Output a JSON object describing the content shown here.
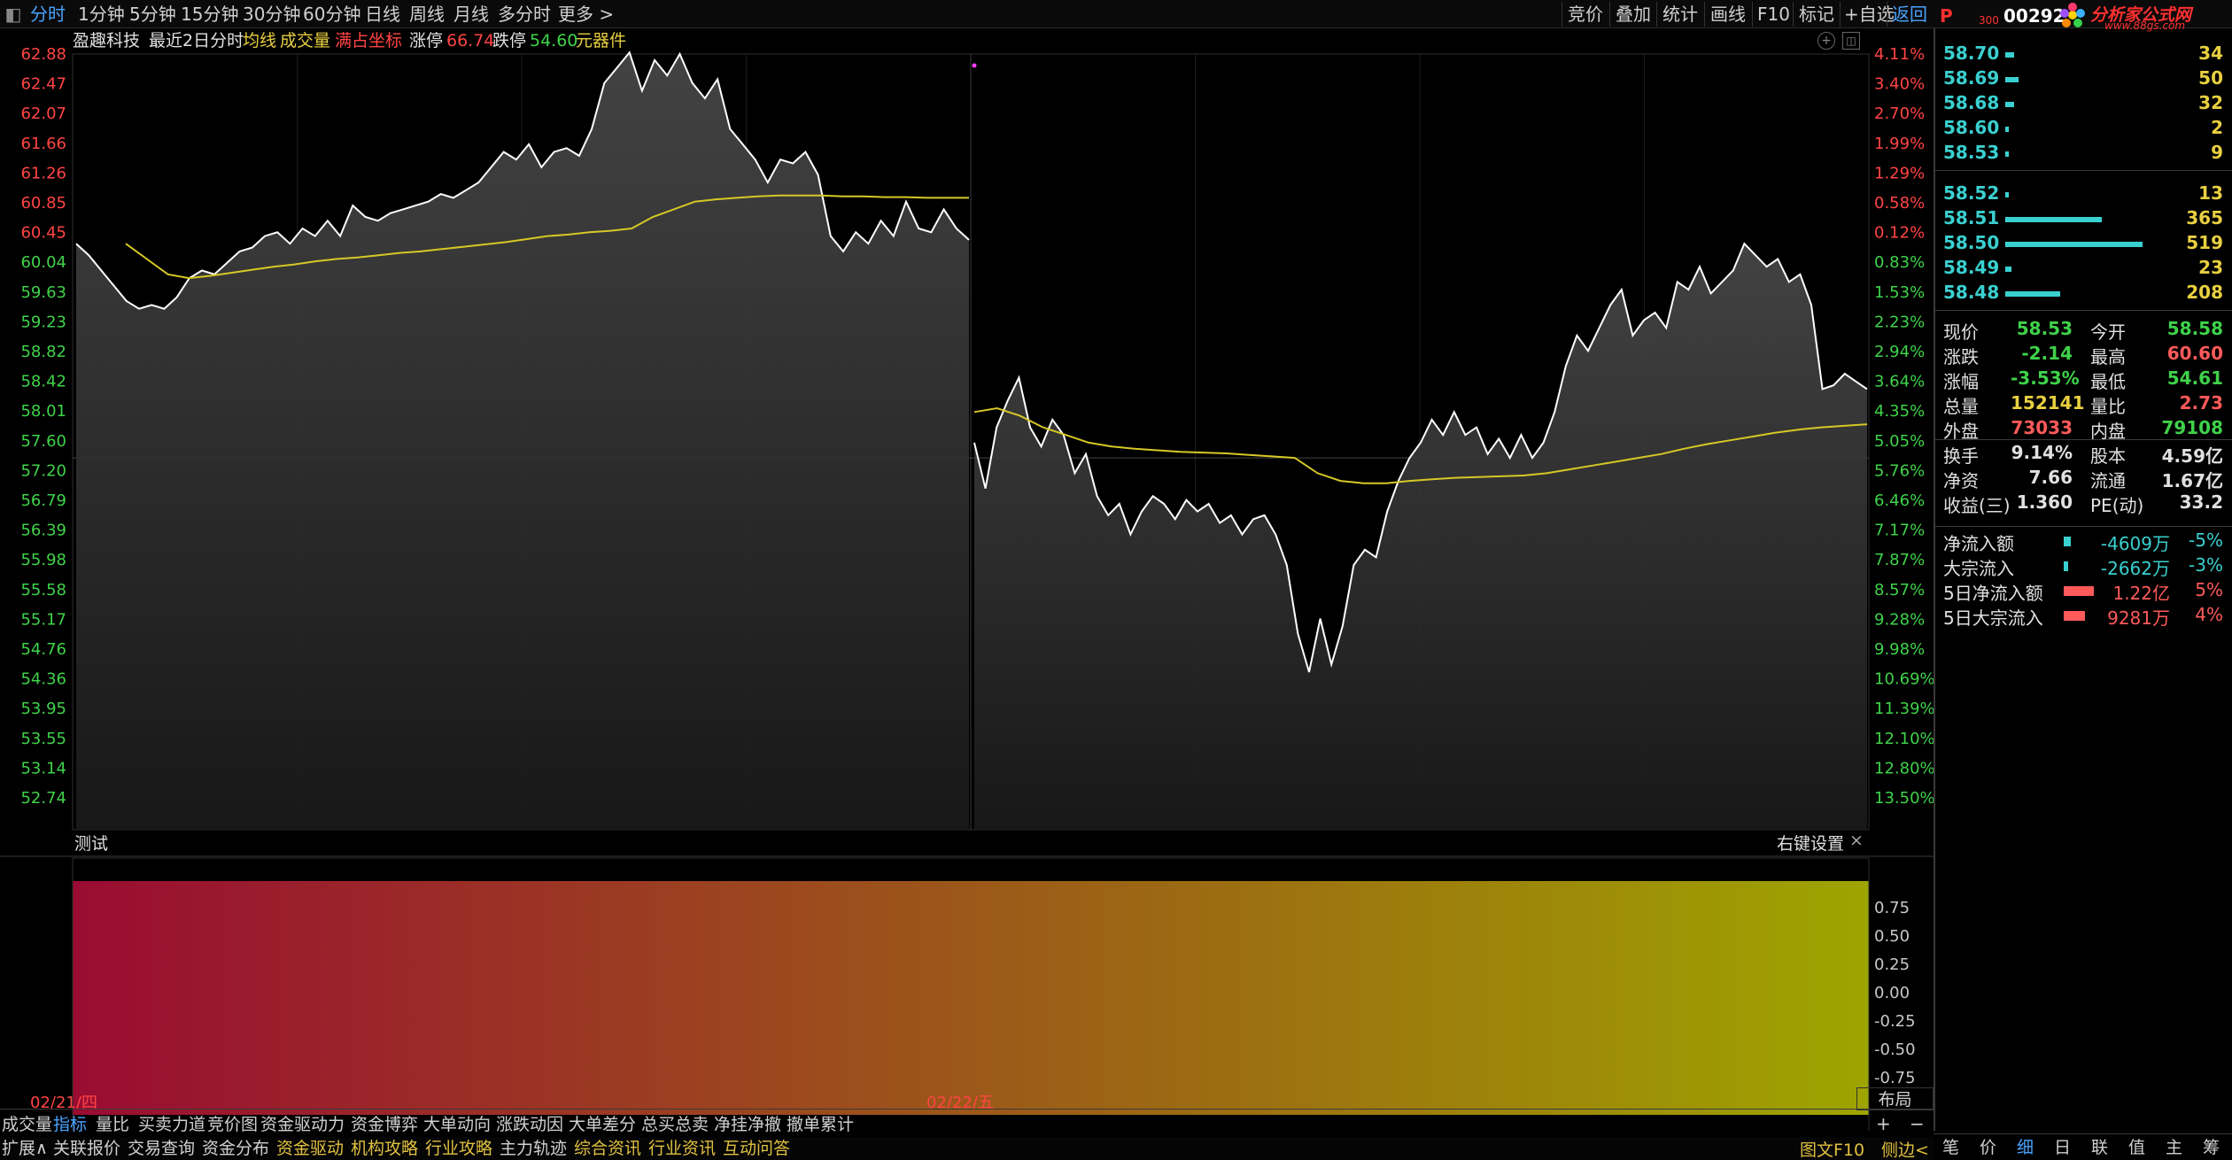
{
  "top_toolbar": {
    "period_tabs": [
      "分时",
      "1分钟",
      "5分钟",
      "15分钟",
      "30分钟",
      "60分钟",
      "日线",
      "周线",
      "月线",
      "多分时",
      "更多 >"
    ],
    "active_tab": "分时",
    "right_tools": [
      "竞价",
      "叠加",
      "统计",
      "画线",
      "F10",
      "标记",
      "+自选",
      "返回"
    ],
    "back_label": "返回"
  },
  "stock": {
    "name": "盈趣科技",
    "mode": "最近2日分时",
    "avg_label": "均线",
    "volume_label": "成交量",
    "fullcoord_label": "满占坐标",
    "limit_up_label": "涨停",
    "limit_up_value": "66.74",
    "limit_down_label": "跌停",
    "limit_down_value": "54.60",
    "sector": "元器件",
    "code": "00292",
    "code_prefix": "P",
    "code_sub": "300"
  },
  "brand": {
    "title": "分析家公式网",
    "url": "www.88gs.com"
  },
  "price_axis": [
    "62.88",
    "62.47",
    "62.07",
    "61.66",
    "61.26",
    "60.85",
    "60.45",
    "60.04",
    "59.63",
    "59.23",
    "58.82",
    "58.42",
    "58.01",
    "57.60",
    "57.20",
    "56.79",
    "56.39",
    "55.98",
    "55.58",
    "55.17",
    "54.76",
    "54.36",
    "53.95",
    "53.55",
    "53.14",
    "52.74"
  ],
  "pct_axis": [
    "4.11%",
    "3.40%",
    "2.70%",
    "1.99%",
    "1.29%",
    "0.58%",
    "0.12%",
    "0.83%",
    "1.53%",
    "2.23%",
    "2.94%",
    "3.64%",
    "4.35%",
    "5.05%",
    "5.76%",
    "6.46%",
    "7.17%",
    "7.87%",
    "8.57%",
    "9.28%",
    "9.98%",
    "10.69%",
    "11.39%",
    "12.10%",
    "12.80%",
    "13.50%"
  ],
  "indicator": {
    "title": "测试",
    "settings_label": "右键设置",
    "close_label": "×",
    "axis": [
      "0.75",
      "0.50",
      "0.25",
      "0.00",
      "-0.25",
      "-0.50",
      "-0.75"
    ]
  },
  "dates": [
    "02/21/四",
    "02/22/五"
  ],
  "colors": {
    "price_line": "#ffffff",
    "avg_line": "#d6c826",
    "axis_up": "#ff4444",
    "axis_down": "#3fd24a",
    "accent": "#4aa3ff",
    "bar_cyan": "#3ad0d0",
    "gradient_start": "#9a0c32",
    "gradient_end": "#9ea400"
  },
  "chart_data": {
    "type": "line",
    "x_sessions": [
      "02/21/四",
      "02/22/五"
    ],
    "ylim": [
      52.74,
      62.88
    ],
    "reference_price": 60.45,
    "series": [
      {
        "name": "价格",
        "session1": [
          60.4,
          60.25,
          60.05,
          59.85,
          59.65,
          59.55,
          59.6,
          59.55,
          59.7,
          59.95,
          60.05,
          60.0,
          60.15,
          60.3,
          60.35,
          60.5,
          60.55,
          60.4,
          60.6,
          60.5,
          60.7,
          60.5,
          60.9,
          60.75,
          60.7,
          60.8,
          60.85,
          60.9,
          60.95,
          61.05,
          61.0,
          61.1,
          61.2,
          61.4,
          61.6,
          61.5,
          61.7,
          61.4,
          61.6,
          61.65,
          61.55,
          61.9,
          62.5,
          62.7,
          62.9,
          62.4,
          62.8,
          62.6,
          62.88,
          62.5,
          62.3,
          62.55,
          61.9,
          61.7,
          61.5,
          61.2,
          61.5,
          61.45,
          61.6,
          61.3,
          60.5,
          60.3,
          60.55,
          60.4,
          60.7,
          60.5,
          60.95,
          60.6,
          60.55,
          60.85,
          60.6,
          60.45
        ],
        "session2": [
          57.8,
          57.2,
          58.0,
          58.35,
          58.65,
          58.0,
          57.75,
          58.1,
          57.9,
          57.4,
          57.65,
          57.1,
          56.85,
          57.0,
          56.6,
          56.9,
          57.1,
          57.0,
          56.8,
          57.05,
          56.9,
          57.0,
          56.75,
          56.85,
          56.6,
          56.8,
          56.85,
          56.6,
          56.2,
          55.3,
          54.8,
          55.5,
          54.9,
          55.4,
          56.2,
          56.4,
          56.3,
          56.9,
          57.3,
          57.6,
          57.8,
          58.1,
          57.9,
          58.2,
          57.9,
          58.0,
          57.65,
          57.85,
          57.6,
          57.9,
          57.6,
          57.8,
          58.2,
          58.8,
          59.2,
          59.0,
          59.3,
          59.6,
          59.8,
          59.2,
          59.4,
          59.5,
          59.3,
          59.9,
          59.8,
          60.1,
          59.75,
          59.9,
          60.05,
          60.4,
          60.25,
          60.1,
          60.2,
          59.9,
          60.0,
          59.6,
          58.5,
          58.55,
          58.7,
          58.6,
          58.5
        ]
      },
      {
        "name": "均价",
        "session1": [
          60.4,
          60.2,
          60.0,
          59.95,
          59.98,
          60.02,
          60.06,
          60.1,
          60.13,
          60.17,
          60.2,
          60.22,
          60.25,
          60.28,
          60.3,
          60.33,
          60.36,
          60.39,
          60.42,
          60.46,
          60.5,
          60.52,
          60.55,
          60.57,
          60.6,
          60.75,
          60.85,
          60.95,
          60.98,
          61.0,
          61.02,
          61.03,
          61.03,
          61.03,
          61.02,
          61.02,
          61.01,
          61.01,
          61.0,
          61.0,
          61.0
        ],
        "session2": [
          58.2,
          58.25,
          58.15,
          58.0,
          57.9,
          57.8,
          57.75,
          57.72,
          57.7,
          57.68,
          57.67,
          57.66,
          57.64,
          57.62,
          57.6,
          57.4,
          57.3,
          57.27,
          57.27,
          57.3,
          57.32,
          57.34,
          57.35,
          57.36,
          57.37,
          57.4,
          57.45,
          57.5,
          57.55,
          57.6,
          57.65,
          57.72,
          57.78,
          57.83,
          57.88,
          57.93,
          57.97,
          58.0,
          58.02,
          58.04
        ]
      }
    ],
    "indicator_series": {
      "name": "测试",
      "ylim": [
        -0.75,
        0.75
      ],
      "gradient": [
        "#9a0c32",
        "#9ea400"
      ]
    },
    "grid": true
  },
  "order_book": {
    "asks": [
      {
        "price": "58.70",
        "vol": "34",
        "bar": 34
      },
      {
        "price": "58.69",
        "vol": "50",
        "bar": 50
      },
      {
        "price": "58.68",
        "vol": "32",
        "bar": 32
      },
      {
        "price": "58.60",
        "vol": "2",
        "bar": 2
      },
      {
        "price": "58.53",
        "vol": "9",
        "bar": 9
      }
    ],
    "bids": [
      {
        "price": "58.52",
        "vol": "13",
        "bar": 13
      },
      {
        "price": "58.51",
        "vol": "365",
        "bar": 365
      },
      {
        "price": "58.50",
        "vol": "519",
        "bar": 519
      },
      {
        "price": "58.49",
        "vol": "23",
        "bar": 23
      },
      {
        "price": "58.48",
        "vol": "208",
        "bar": 208
      }
    ]
  },
  "quote_stats": [
    {
      "l1": "现价",
      "v1": "58.53",
      "c1": "#3fd24a",
      "l2": "今开",
      "v2": "58.58",
      "c2": "#3fd24a"
    },
    {
      "l1": "涨跌",
      "v1": "-2.14",
      "c1": "#3fd24a",
      "l2": "最高",
      "v2": "60.60",
      "c2": "#ff5a5a"
    },
    {
      "l1": "涨幅",
      "v1": "-3.53%",
      "c1": "#3fd24a",
      "l2": "最低",
      "v2": "54.61",
      "c2": "#3fd24a"
    },
    {
      "l1": "总量",
      "v1": "152141",
      "c1": "#e8d040",
      "l2": "量比",
      "v2": "2.73",
      "c2": "#ff5a5a"
    },
    {
      "l1": "外盘",
      "v1": "73033",
      "c1": "#ff5a5a",
      "l2": "内盘",
      "v2": "79108",
      "c2": "#3fd24a"
    },
    {
      "l1": "换手",
      "v1": "9.14%",
      "c1": "#e0e0e0",
      "l2": "股本",
      "v2": "4.59亿",
      "c2": "#e0e0e0"
    },
    {
      "l1": "净资",
      "v1": "7.66",
      "c1": "#e0e0e0",
      "l2": "流通",
      "v2": "1.67亿",
      "c2": "#e0e0e0"
    },
    {
      "l1": "收益(三)",
      "v1": "1.360",
      "c1": "#e0e0e0",
      "l2": "PE(动)",
      "v2": "33.2",
      "c2": "#e0e0e0"
    }
  ],
  "money_flow": [
    {
      "label": "净流入额",
      "value": "-4609万",
      "pct": "-5%",
      "color": "#3ad0d0",
      "bar": 8
    },
    {
      "label": "大宗流入",
      "value": "-2662万",
      "pct": "-3%",
      "color": "#3ad0d0",
      "bar": 5
    },
    {
      "label": "5日净流入额",
      "value": "1.22亿",
      "pct": "5%",
      "color": "#ff5a5a",
      "bar": 34
    },
    {
      "label": "5日大宗流入",
      "value": "9281万",
      "pct": "4%",
      "color": "#ff5a5a",
      "bar": 24
    }
  ],
  "bottom_tabs_row1": [
    "成交量",
    "指标",
    "量比",
    "买卖力道",
    "竞价图",
    "资金驱动力",
    "资金博弈",
    "大单动向",
    "涨跌动因",
    "大单差分",
    "总买总卖",
    "净挂净撤",
    "撤单累计"
  ],
  "bottom_tabs_row1_active": "指标",
  "layout_label": "布局",
  "plus_label": "+",
  "minus_label": "−",
  "bottom_tabs_row2": [
    "扩展∧",
    "关联报价",
    "交易查询",
    "资金分布",
    "资金驱动",
    "机构攻略",
    "行业攻略",
    "主力轨迹",
    "综合资讯",
    "行业资讯",
    "互动问答"
  ],
  "bottom_right": {
    "f10": "图文F10",
    "side": "侧边<"
  },
  "panel_tabs": [
    "笔",
    "价",
    "细",
    "日",
    "联",
    "值",
    "主",
    "筹"
  ],
  "panel_tabs_active": "细"
}
